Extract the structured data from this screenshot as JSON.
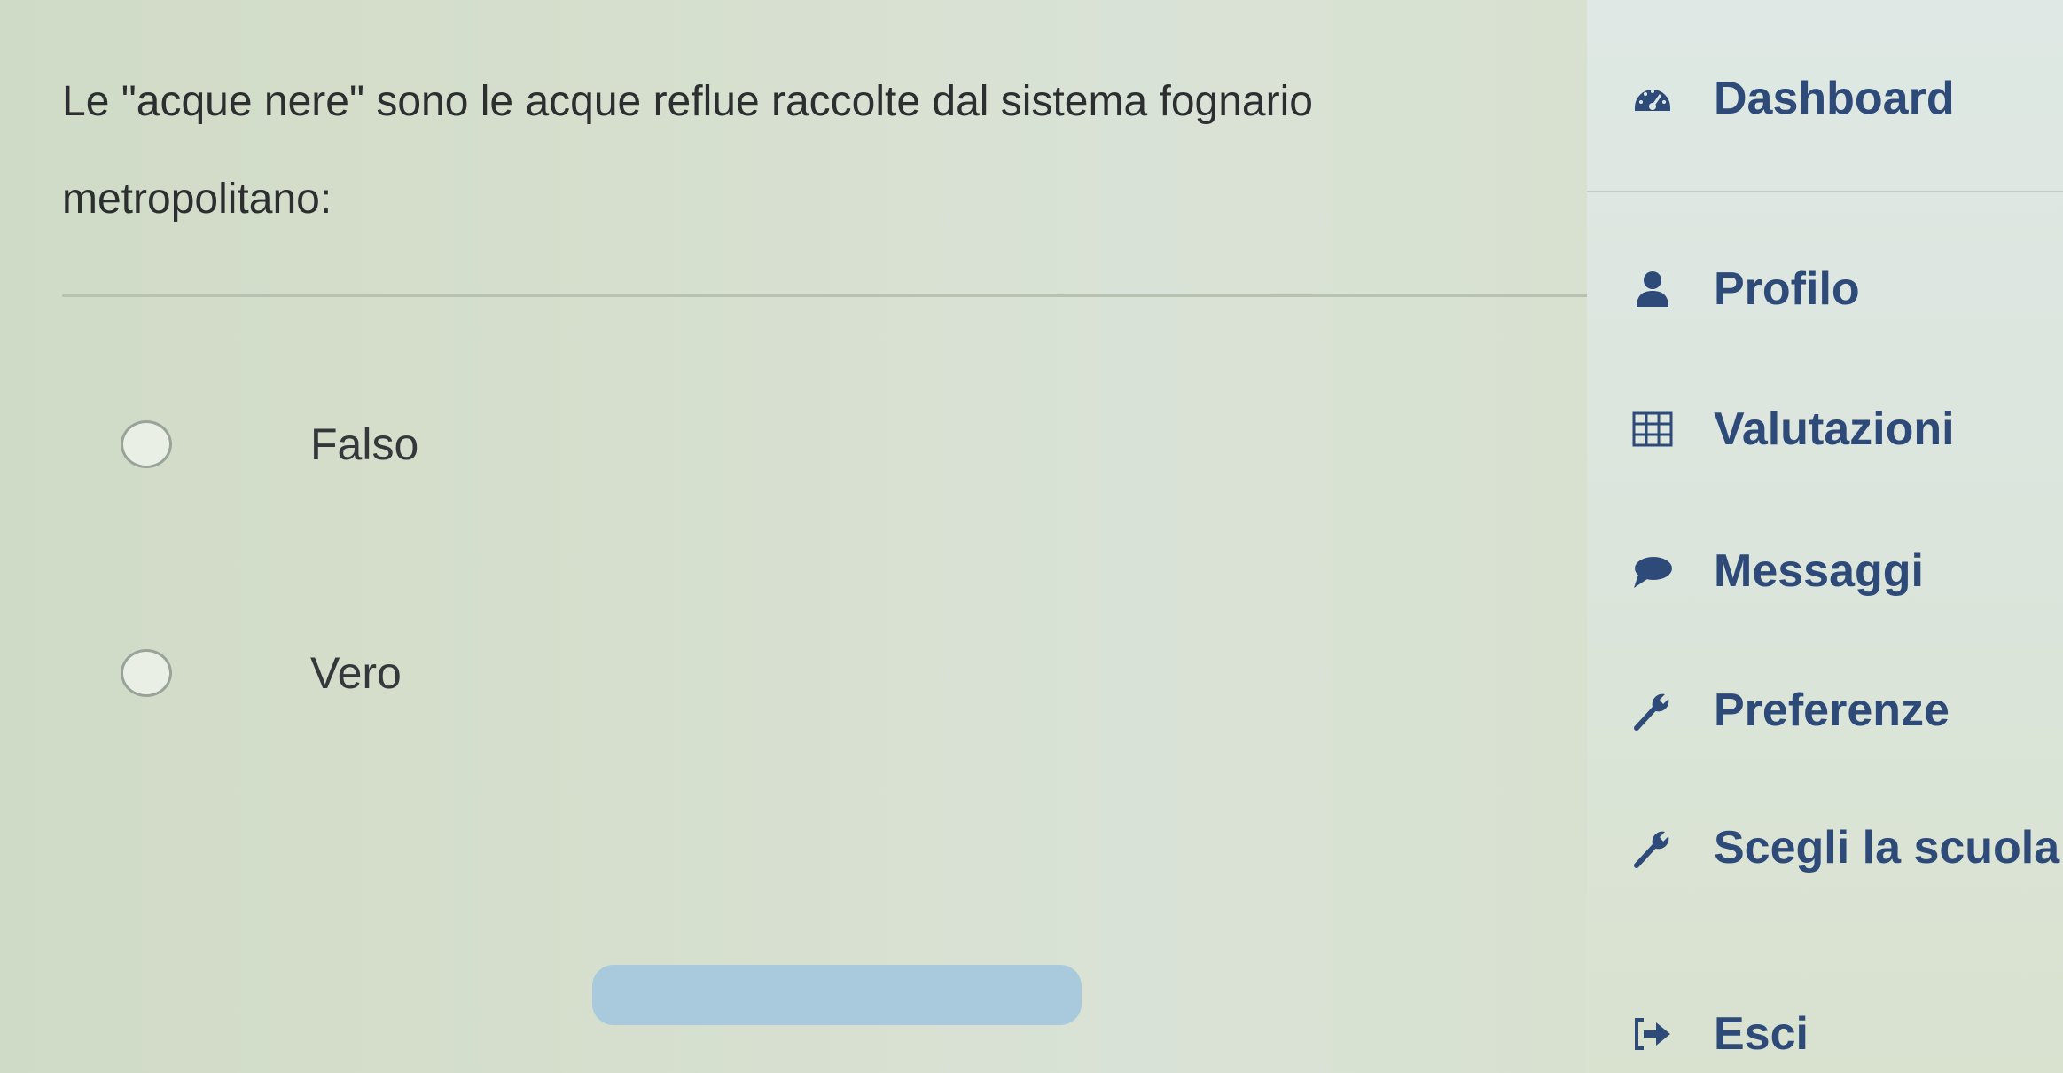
{
  "question": {
    "line1": "Le \"acque nere\" sono le acque reflue raccolte dal sistema fognario",
    "line2": "metropolitano:"
  },
  "options": [
    {
      "label": "Falso",
      "selected": false
    },
    {
      "label": "Vero",
      "selected": false
    }
  ],
  "sidebar": {
    "items": [
      {
        "label": "Dashboard",
        "icon": "dashboard-icon"
      },
      {
        "label": "Profilo",
        "icon": "user-icon"
      },
      {
        "label": "Valutazioni",
        "icon": "table-icon"
      },
      {
        "label": "Messaggi",
        "icon": "chat-bubble-icon"
      },
      {
        "label": "Preferenze",
        "icon": "wrench-icon"
      },
      {
        "label": "Scegli la scuola",
        "icon": "wrench-icon"
      },
      {
        "label": "Esci",
        "icon": "logout-icon"
      }
    ]
  },
  "colors": {
    "accent": "#2e4a78",
    "button": "#a9cadc",
    "text": "#2c2f30"
  }
}
